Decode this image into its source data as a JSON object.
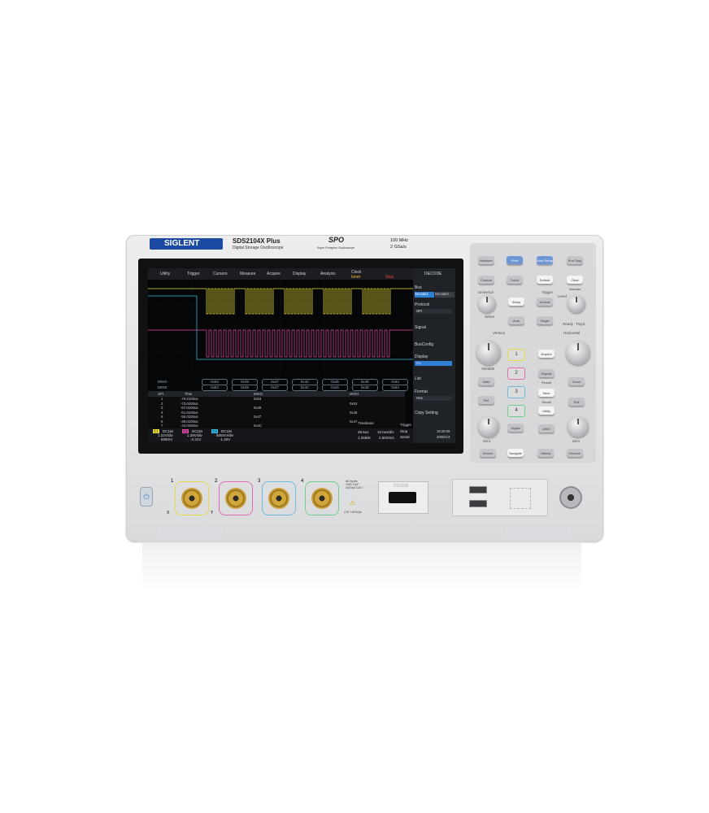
{
  "brand": {
    "logo_text": "SIGLENT",
    "model": "SDS2104X Plus",
    "subtitle": "Digital Storage Oscilloscope",
    "spo": "SPO",
    "spo_sub": "Super Phosphor Oscilloscope",
    "bandwidth": "100 MHz",
    "sample_rate": "2 GSa/s"
  },
  "screen": {
    "menu_tabs": [
      "Utility",
      "Trigger",
      "Cursors",
      "Measure",
      "Acquire",
      "Display",
      "Analysis"
    ],
    "clock": {
      "label": "Clock",
      "value": "Inner"
    },
    "run_state": "Stop",
    "decode_title": "DECODE",
    "bus_rows": [
      {
        "label": "MISO",
        "values": [
          "0x53",
          "0x49",
          "0x47",
          "0x4C",
          "0x45",
          "0x4E",
          "0x54"
        ]
      },
      {
        "label": "MOSI",
        "values": [
          "0x53",
          "0x49",
          "0x47",
          "0x4C",
          "0x45",
          "0x4E",
          "0x54"
        ]
      }
    ],
    "table": {
      "headers": [
        "SPI",
        "Time",
        "MISO",
        "MOSI"
      ],
      "rows": [
        {
          "n": "1",
          "time": "-79.0100us",
          "miso": "0x53",
          "mosi": ""
        },
        {
          "n": "2",
          "time": "-73.0100us",
          "miso": "",
          "mosi": "0x53"
        },
        {
          "n": "3",
          "time": "-67.0100us",
          "miso": "0x49",
          "mosi": ""
        },
        {
          "n": "4",
          "time": "-61.0100us",
          "miso": "",
          "mosi": "0x49"
        },
        {
          "n": "5",
          "time": "-55.0100us",
          "miso": "0x47",
          "mosi": ""
        },
        {
          "n": "6",
          "time": "-49.0100us",
          "miso": "",
          "mosi": "0x47"
        },
        {
          "n": "7",
          "time": "-43.0100us",
          "miso": "0x4C",
          "mosi": ""
        }
      ]
    },
    "channels": [
      {
        "ch": "C1",
        "coupling": "DC1M",
        "vdiv": "1.22V/div",
        "offset": "508mV",
        "color": "#f2e33a"
      },
      {
        "ch": "C2",
        "coupling": "DC1M",
        "vdiv": "1.28V/div",
        "offset": "-3.31V",
        "color": "#e34aa8"
      },
      {
        "ch": "C3",
        "coupling": "DC1M",
        "vdiv": "500mV/div",
        "offset": "-1.40V",
        "color": "#39c2e8"
      }
    ],
    "timebase": {
      "label": "Timebase",
      "delay": "48.5us",
      "tdiv": "10.0us/div",
      "points": "1.25MS",
      "sa": "2.50GS/s"
    },
    "trigger": {
      "label": "Trigger",
      "mode": "Stop",
      "type": "Serial",
      "ch": "2"
    },
    "datetime": {
      "time": "19:20:59",
      "date": "2000/1/3"
    },
    "right_menu": {
      "bus_label": "Bus",
      "bus_tabs": [
        "Decode1",
        "Decode2"
      ],
      "protocol_label": "Protocol",
      "protocol_value": "SPI",
      "signal": "Signal",
      "busconfig": "BusConfig",
      "display_label": "Display",
      "display_value": "On",
      "list": "List",
      "format_label": "Format",
      "format_value": "Hex",
      "copy": "Copy Setting"
    }
  },
  "panel": {
    "top_buttons": [
      "Measure",
      "Print",
      "Auto Setup",
      "Run Stop",
      "Cursors",
      "Touch",
      "Default",
      "Clear Sweeps"
    ],
    "universal": {
      "label": "Universal",
      "select": "Select"
    },
    "trigger": {
      "label": "Trigger",
      "level": "Level",
      "setup": "Setup",
      "normal": "Normal",
      "auto": "Auto",
      "single": "Single",
      "fifty": "50%",
      "ready": "Ready",
      "trigd": "Trig'd"
    },
    "vertical": {
      "label": "Vertical",
      "variable": "Variable",
      "zero": "Zero",
      "math": "Math",
      "ref": "Ref",
      "digital": "Digital",
      "channels": [
        "1",
        "2",
        "3",
        "4"
      ]
    },
    "horizontal": {
      "label": "Horizontal",
      "acquire": "Acquire",
      "history": "History",
      "zoom": "Zoom",
      "roll": "Roll",
      "zero": "Zero"
    },
    "middle_buttons": [
      "Display Persist",
      "Save Recall",
      "Utility",
      "AWG"
    ],
    "bottom_buttons": [
      "Search",
      "Navigate",
      "History",
      "Decode"
    ]
  },
  "front": {
    "inputs": [
      "1",
      "2",
      "3",
      "4"
    ],
    "xy": [
      "X",
      "Y"
    ],
    "warning": "All Inputs 1MΩ 17pF 400Vpk CAT I",
    "cat": "CAT I 400Vpk",
    "digital": "DO-D15"
  }
}
